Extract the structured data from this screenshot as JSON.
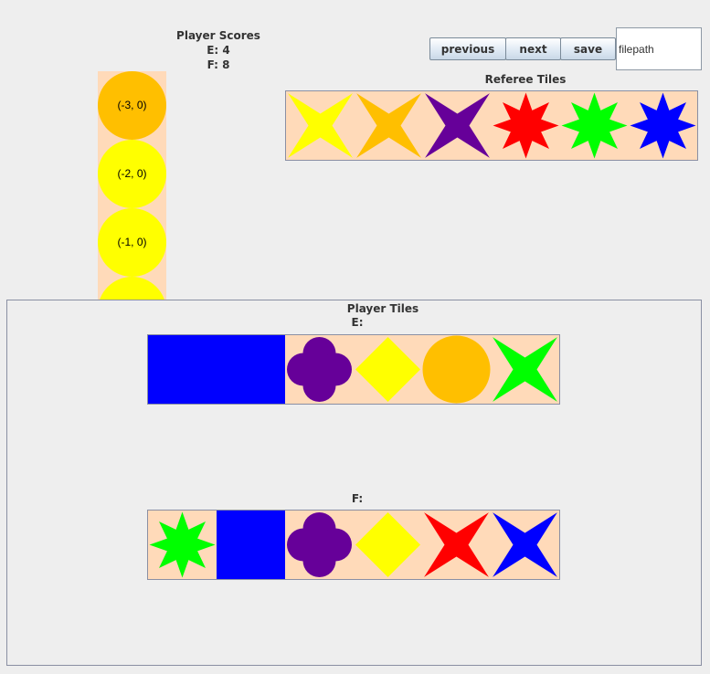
{
  "scores": {
    "heading": "Player Scores",
    "entries": [
      "E: 4",
      "F: 8"
    ]
  },
  "board": {
    "cells": [
      {
        "label": "(-3, 0)",
        "color": "#ffbf00"
      },
      {
        "label": "(-2, 0)",
        "color": "#ffff00"
      },
      {
        "label": "(-1, 0)",
        "color": "#ffff00"
      },
      {
        "label": "",
        "color": "#ffff00"
      }
    ]
  },
  "toolbar": {
    "previous_label": "previous",
    "next_label": "next",
    "save_label": "save",
    "filepath_value": "filepath"
  },
  "referee": {
    "heading": "Referee Tiles",
    "tiles": [
      {
        "shape": "star-4",
        "color": "#ffff00"
      },
      {
        "shape": "star-4",
        "color": "#ffbf00"
      },
      {
        "shape": "star-4",
        "color": "#660099"
      },
      {
        "shape": "star-8",
        "color": "#ff0000"
      },
      {
        "shape": "star-8",
        "color": "#00ff00"
      },
      {
        "shape": "star-8",
        "color": "#0000ff"
      }
    ]
  },
  "players": {
    "heading": "Player Tiles",
    "list": [
      {
        "name": "E:",
        "tiles": [
          {
            "shape": "square",
            "color": "#0000ff"
          },
          {
            "shape": "square",
            "color": "#0000ff"
          },
          {
            "shape": "clover",
            "color": "#660099"
          },
          {
            "shape": "diamond",
            "color": "#ffff00"
          },
          {
            "shape": "circle",
            "color": "#ffbf00"
          },
          {
            "shape": "star-4",
            "color": "#00ff00"
          }
        ]
      },
      {
        "name": "F:",
        "tiles": [
          {
            "shape": "star-8",
            "color": "#00ff00"
          },
          {
            "shape": "square",
            "color": "#0000ff"
          },
          {
            "shape": "clover",
            "color": "#660099"
          },
          {
            "shape": "diamond",
            "color": "#ffff00"
          },
          {
            "shape": "star-4",
            "color": "#ff0000"
          },
          {
            "shape": "star-4",
            "color": "#0000ff"
          }
        ]
      }
    ]
  }
}
